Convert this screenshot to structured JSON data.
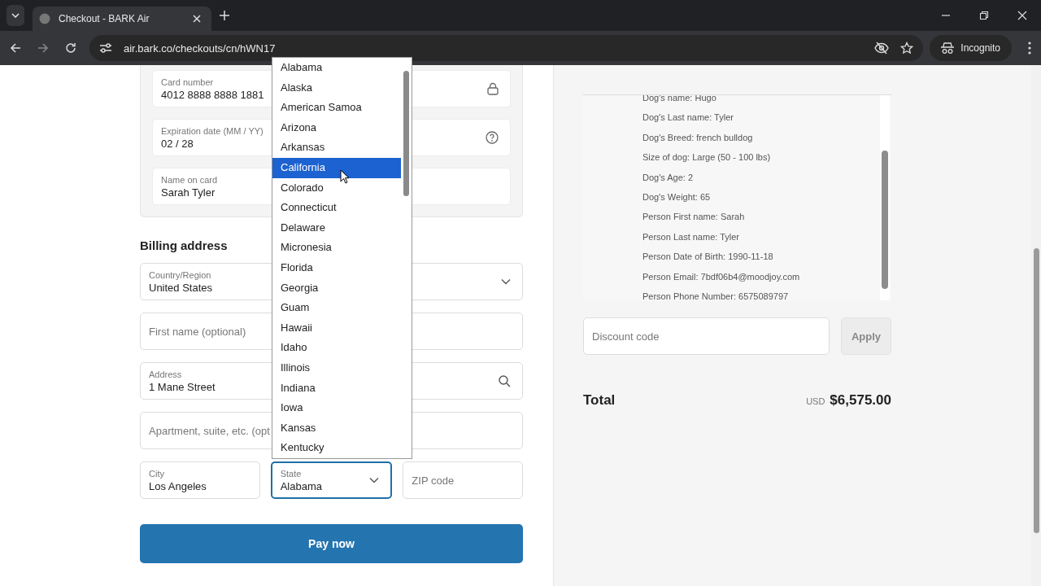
{
  "browser": {
    "tab_title": "Checkout - BARK Air",
    "url": "air.bark.co/checkouts/cn/hWN17",
    "profile": "Incognito"
  },
  "card": {
    "fields": [
      {
        "label": "Card number",
        "value": "4012 8888 8888 1881",
        "kind": "lock"
      },
      {
        "label": "Expiration date (MM / YY)",
        "value": "02 / 28",
        "kind": "help"
      },
      {
        "label": "Name on card",
        "value": "Sarah Tyler",
        "kind": "plain"
      }
    ]
  },
  "billing": {
    "heading": "Billing address",
    "country": {
      "label": "Country/Region",
      "value": "United States"
    },
    "first_name": {
      "placeholder": "First name (optional)"
    },
    "address": {
      "label": "Address",
      "value": "1 Mane Street"
    },
    "apartment": {
      "placeholder": "Apartment, suite, etc. (opt"
    },
    "city": {
      "label": "City",
      "value": "Los Angeles"
    },
    "state": {
      "label": "State",
      "value": "Alabama",
      "focused": true
    },
    "zip": {
      "placeholder": "ZIP code"
    }
  },
  "state_dropdown": {
    "options": [
      {
        "label": "Alabama",
        "selected": false
      },
      {
        "label": "Alaska",
        "selected": false
      },
      {
        "label": "American Samoa",
        "selected": false
      },
      {
        "label": "Arizona",
        "selected": false
      },
      {
        "label": "Arkansas",
        "selected": false
      },
      {
        "label": "California",
        "selected": true
      },
      {
        "label": "Colorado",
        "selected": false
      },
      {
        "label": "Connecticut",
        "selected": false
      },
      {
        "label": "Delaware",
        "selected": false
      },
      {
        "label": "Micronesia",
        "selected": false
      },
      {
        "label": "Florida",
        "selected": false
      },
      {
        "label": "Georgia",
        "selected": false
      },
      {
        "label": "Guam",
        "selected": false
      },
      {
        "label": "Hawaii",
        "selected": false
      },
      {
        "label": "Idaho",
        "selected": false
      },
      {
        "label": "Illinois",
        "selected": false
      },
      {
        "label": "Indiana",
        "selected": false
      },
      {
        "label": "Iowa",
        "selected": false
      },
      {
        "label": "Kansas",
        "selected": false
      },
      {
        "label": "Kentucky",
        "selected": false
      }
    ]
  },
  "pay_button": "Pay now",
  "order_details": [
    "Dog's name: Hugo",
    "Dog's Last name: Tyler",
    "Dog's Breed: french bulldog",
    "Size of dog: Large (50 - 100 lbs)",
    "Dog's Age: 2",
    "Dog's Weight: 65",
    "Person First name: Sarah",
    "Person Last name: Tyler",
    "Person Date of Birth: 1990-11-18",
    "Person Email: 7bdf06b4@moodjoy.com",
    "Person Phone Number: 6575089797"
  ],
  "discount": {
    "placeholder": "Discount code",
    "button": "Apply"
  },
  "total": {
    "label": "Total",
    "currency": "USD",
    "amount": "$6,575.00"
  }
}
